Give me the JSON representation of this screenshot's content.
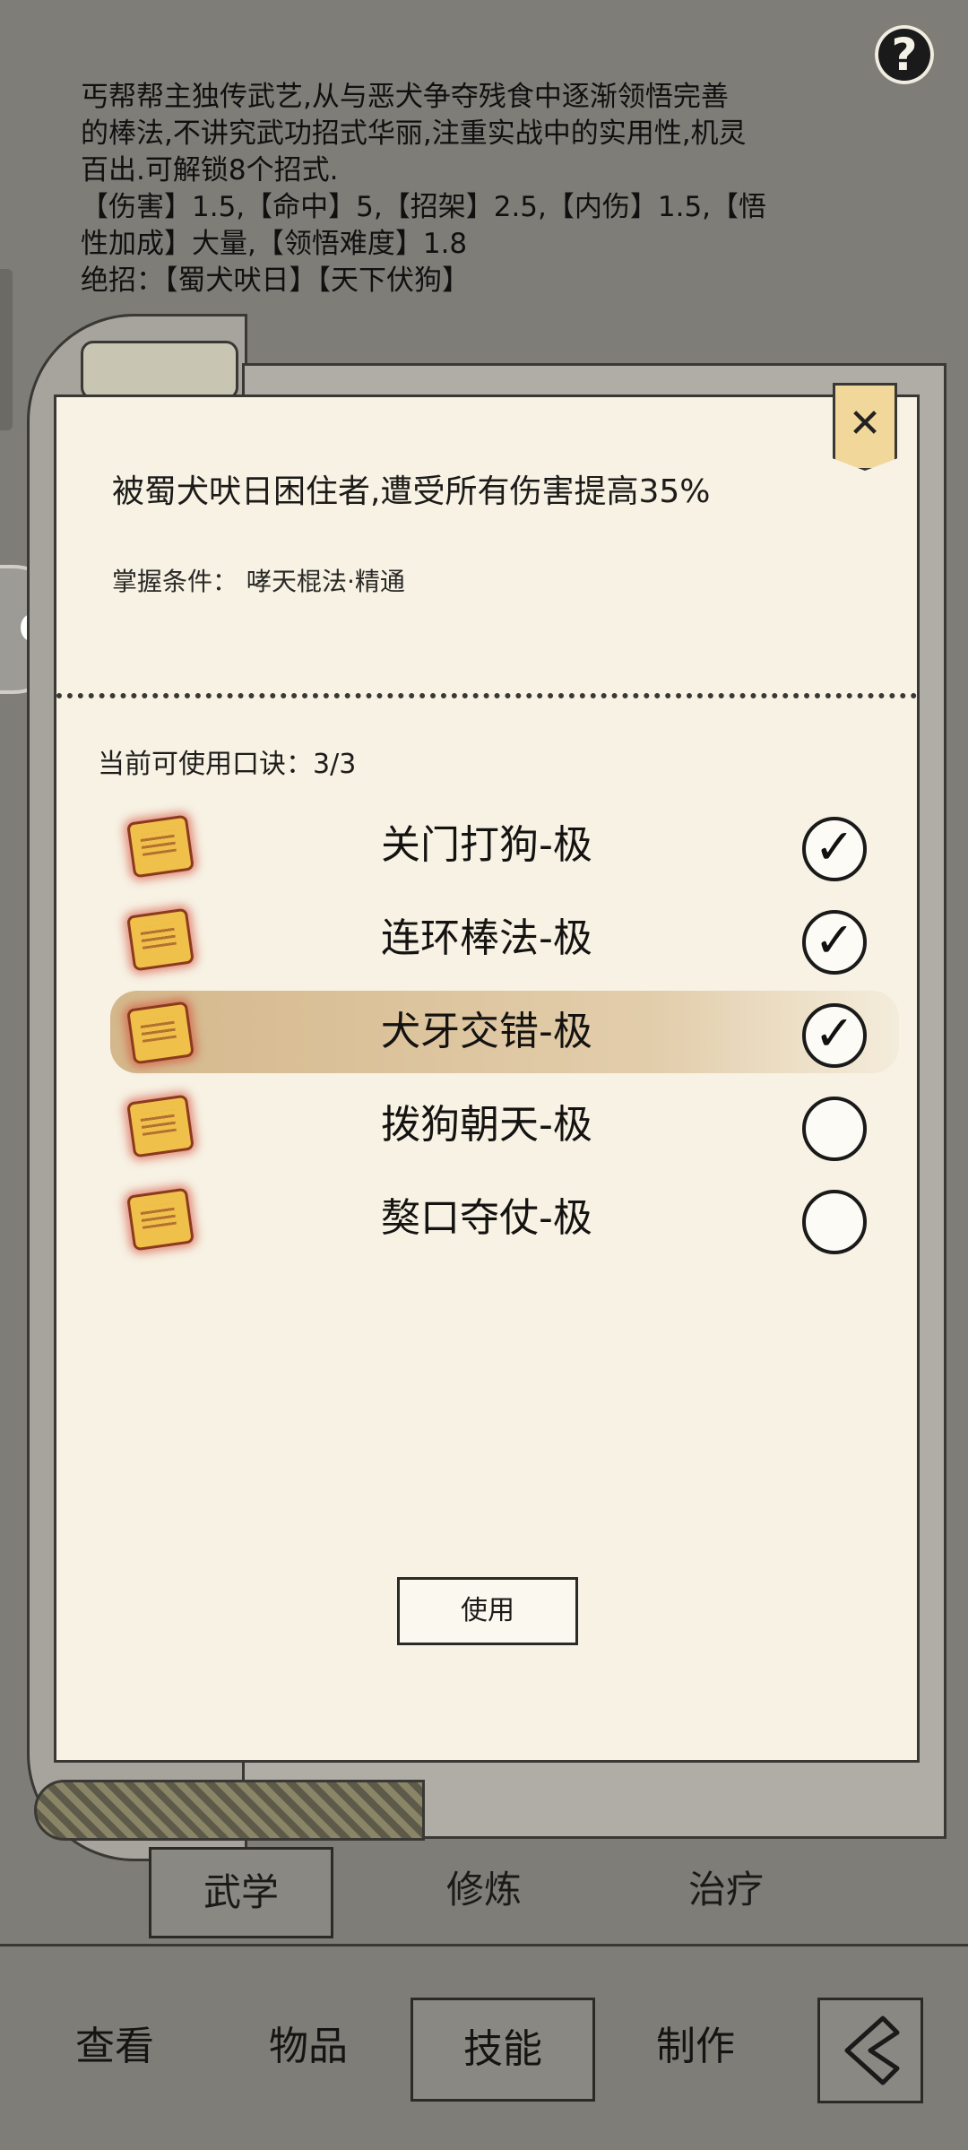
{
  "description": {
    "lines": [
      "丐帮帮主独传武艺,从与恶犬争夺残食中逐渐领悟完善",
      "的棒法,不讲究武功招式华丽,注重实战中的实用性,机灵",
      "百出.可解锁8个招式.",
      "【伤害】1.5,【命中】5,【招架】2.5,【内伤】1.5,【悟",
      "性加成】大量,【领悟难度】1.8",
      "绝招：【蜀犬吠日】【天下伏狗】"
    ]
  },
  "help_icon": "?",
  "side_float_label": "C",
  "dialog": {
    "close_icon": "✕",
    "title": "被蜀犬吠日困住者,遭受所有伤害提高35%",
    "condition_label": "掌握条件：",
    "condition_value": "哮天棍法·精通",
    "slots_text": "当前可使用口诀：3/3",
    "moves": [
      {
        "name": "关门打狗-极",
        "checked": true,
        "selected": false
      },
      {
        "name": "连环棒法-极",
        "checked": true,
        "selected": false
      },
      {
        "name": "犬牙交错-极",
        "checked": true,
        "selected": true
      },
      {
        "name": "拨狗朝天-极",
        "checked": false,
        "selected": false
      },
      {
        "name": "獒口夺仗-极",
        "checked": false,
        "selected": false
      }
    ],
    "use_label": "使用"
  },
  "subtabs": {
    "martial": "武学",
    "cultivate": "修炼",
    "heal": "治疗",
    "active": "武学"
  },
  "bottom_nav": {
    "view": "查看",
    "items": "物品",
    "skills": "技能",
    "craft": "制作",
    "active": "技能"
  },
  "colors": {
    "background": "#7f7d77",
    "dialog": "#f7f2e4",
    "selected_row": "#c9a46e",
    "icon_gold": "#f0c14a"
  }
}
